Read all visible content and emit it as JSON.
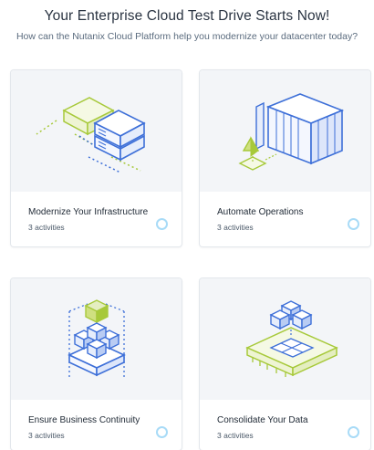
{
  "header": {
    "title": "Your Enterprise Cloud Test Drive Starts Now!",
    "subtitle": "How can the Nutanix Cloud Platform help you modernize your datacenter today?"
  },
  "cards": [
    {
      "title": "Modernize Your Infrastructure",
      "subtitle": "3 activities",
      "illustration_icon": "stacked-servers-icon"
    },
    {
      "title": "Automate Operations",
      "subtitle": "3 activities",
      "illustration_icon": "datacenter-container-icon"
    },
    {
      "title": "Ensure Business Continuity",
      "subtitle": "3 activities",
      "illustration_icon": "replicated-cubes-icon"
    },
    {
      "title": "Consolidate Your Data",
      "subtitle": "3 activities",
      "illustration_icon": "data-blocks-icon"
    }
  ],
  "colors": {
    "accent_blue": "#3d6fd8",
    "accent_green": "#a7c93a",
    "card_top_bg": "#f3f5f8",
    "status_ring": "#a8dbf7"
  }
}
